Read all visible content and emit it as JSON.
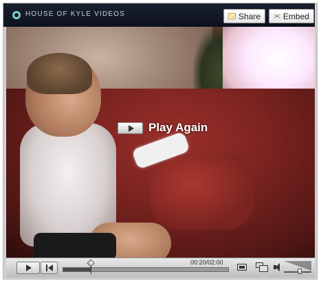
{
  "header": {
    "brand": "HOUSE OF KYLE VIDEOS",
    "share_label": "Share",
    "embed_label": "Embed"
  },
  "overlay": {
    "play_again_label": "Play Again"
  },
  "controls": {
    "time_display": "00:20/02:00",
    "progress_fraction": 0.17,
    "volume_fraction": 0.6
  },
  "icons": [
    "logo-icon",
    "mail-icon",
    "embed-icon",
    "play-icon",
    "rewind-icon",
    "expand-icon",
    "fullscreen-icon",
    "volume-icon"
  ]
}
